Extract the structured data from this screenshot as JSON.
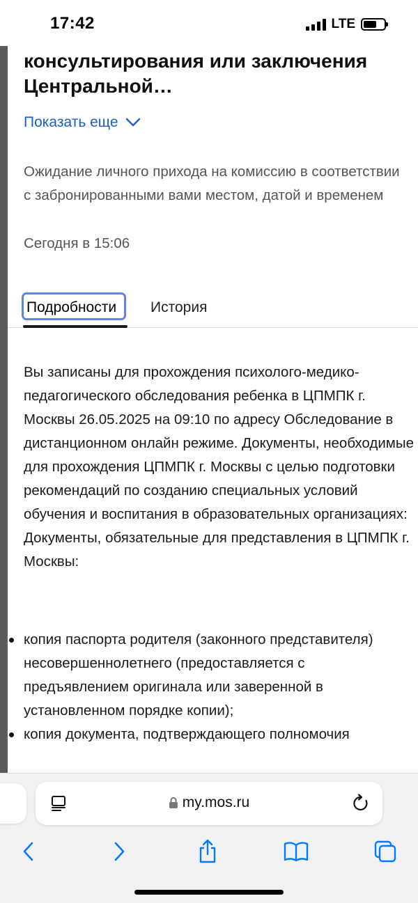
{
  "status_bar": {
    "time": "17:42",
    "network": "LTE"
  },
  "page": {
    "title": "консультирования или заключения Центральной…",
    "show_more": "Показать еще",
    "status_description": "Ожидание личного прихода на комиссию в соответствии с забронированными вами местом, датой и временем",
    "status_date": "Сегодня в 15:06"
  },
  "tabs": {
    "details": "Подробности",
    "history": "История"
  },
  "details": {
    "paragraph": "Вы записаны для прохождения психолого-медико-педагогического обследования ребенка в ЦПМПК г. Москвы 26.05.2025 на 09:10 по адресу Обследование в дистанционном онлайн режиме. Документы, необходимые для прохождения ЦПМПК г. Москвы с целью подготовки рекомендаций по созданию специальных условий обучения и воспитания в образовательных организациях:",
    "required_heading": "Документы, обязательные для представления в ЦПМПК г. Москвы:",
    "bullets": [
      "копия паспорта родителя (законного представителя) несовершеннолетнего (предоставляется с предъявлением оригинала или заверенной в установленном порядке копии);",
      "копия документа, подтверждающего полномочия"
    ]
  },
  "browser": {
    "url": "my.mos.ru",
    "icons": {
      "reader": "reader-icon",
      "lock": "lock-icon",
      "reload": "reload-icon",
      "back": "chevron-left-icon",
      "forward": "chevron-right-icon",
      "share": "share-icon",
      "bookmarks": "book-icon",
      "tabs": "tabs-icon"
    },
    "accent_color": "#007aff"
  }
}
